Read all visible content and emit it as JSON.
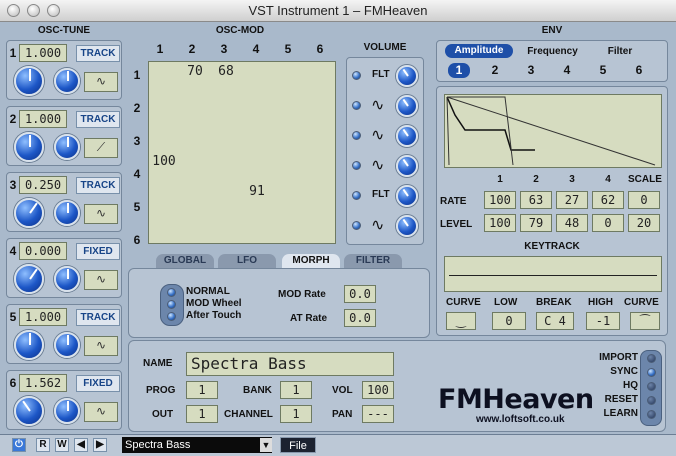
{
  "window": {
    "title": "VST Instrument 1 – FMHeaven"
  },
  "osc_tune": {
    "title": "OSC-TUNE",
    "rows": [
      {
        "index": "1",
        "value": "1.000",
        "mode": "TRACK",
        "wave": "∿"
      },
      {
        "index": "2",
        "value": "1.000",
        "mode": "TRACK",
        "wave": "⟋"
      },
      {
        "index": "3",
        "value": "0.250",
        "mode": "TRACK",
        "wave": "∿"
      },
      {
        "index": "4",
        "value": "0.000",
        "mode": "FIXED",
        "wave": "∿"
      },
      {
        "index": "5",
        "value": "1.000",
        "mode": "TRACK",
        "wave": "∿"
      },
      {
        "index": "6",
        "value": "1.562",
        "mode": "FIXED",
        "wave": "∿"
      }
    ]
  },
  "osc_mod": {
    "title": "OSC-MOD",
    "cols": [
      "1",
      "2",
      "3",
      "4",
      "5",
      "6"
    ],
    "rows": [
      "1",
      "2",
      "3",
      "4",
      "5",
      "6"
    ],
    "cells": [
      [
        "",
        "70",
        "68",
        "",
        "",
        ""
      ],
      [
        "",
        "",
        "",
        "",
        "",
        ""
      ],
      [
        "",
        "",
        "",
        "",
        "",
        ""
      ],
      [
        "100",
        "",
        "",
        "",
        "",
        ""
      ],
      [
        "",
        "",
        "",
        "91",
        "",
        ""
      ],
      [
        "",
        "",
        "",
        "",
        "",
        ""
      ]
    ]
  },
  "volume": {
    "title": "VOLUME",
    "items": [
      {
        "label": "FLT",
        "wave": ""
      },
      {
        "label": "",
        "wave": "∿"
      },
      {
        "label": "",
        "wave": "∿"
      },
      {
        "label": "",
        "wave": "∿"
      },
      {
        "label": "FLT",
        "wave": ""
      },
      {
        "label": "",
        "wave": "∿"
      }
    ]
  },
  "env": {
    "title": "ENV",
    "tabs": [
      "Amplitude",
      "Frequency",
      "Filter"
    ],
    "osc_numbers": [
      "1",
      "2",
      "3",
      "4",
      "5",
      "6"
    ],
    "rate_label": "RATE",
    "level_label": "LEVEL",
    "col_headers": [
      "1",
      "2",
      "3",
      "4",
      "SCALE"
    ],
    "rate_values": [
      "100",
      "63",
      "27",
      "62",
      "0"
    ],
    "level_values": [
      "100",
      "79",
      "48",
      "0",
      "20"
    ],
    "keytrack": "KEYTRACK",
    "kt_labels": [
      "CURVE",
      "LOW",
      "BREAK",
      "HIGH",
      "CURVE"
    ],
    "low": "0",
    "break": "C 4",
    "high": "-1"
  },
  "tabs": [
    "GLOBAL",
    "LFO",
    "MORPH",
    "FILTER"
  ],
  "morph": {
    "sources": [
      "NORMAL",
      "MOD Wheel",
      "After Touch"
    ],
    "mod_rate_label": "MOD Rate",
    "mod_rate": "0.0",
    "at_rate_label": "AT Rate",
    "at_rate": "0.0"
  },
  "global": {
    "name_label": "NAME",
    "name": "Spectra Bass",
    "prog_label": "PROG",
    "prog": "1",
    "bank_label": "BANK",
    "bank": "1",
    "vol_label": "VOL",
    "vol": "100",
    "out_label": "OUT",
    "out": "1",
    "channel_label": "CHANNEL",
    "channel": "1",
    "pan_label": "PAN",
    "pan": "---"
  },
  "right_flags": [
    "IMPORT",
    "SYNC",
    "HQ",
    "RESET",
    "LEARN"
  ],
  "brand": {
    "logo": "FMHeaven",
    "url": "www.loftsoft.co.uk"
  },
  "bottom": {
    "buttons": [
      "R",
      "W",
      "◀",
      "▶"
    ],
    "preset": "Spectra Bass",
    "file_btn": "File"
  }
}
